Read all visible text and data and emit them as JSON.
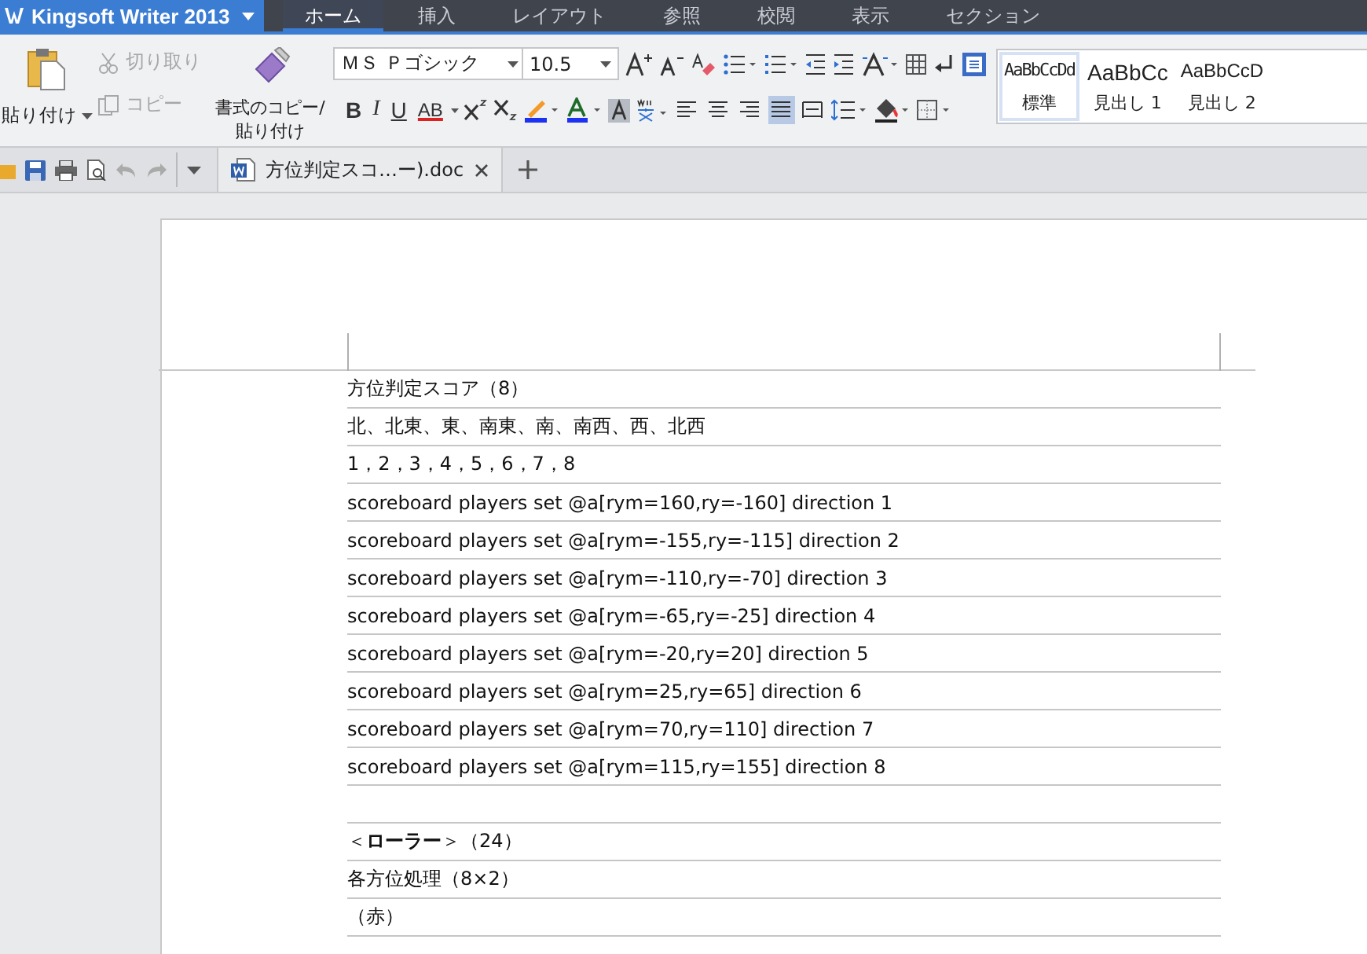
{
  "app": {
    "title": "Kingsoft Writer 2013"
  },
  "menu_tabs": [
    {
      "label": "ホーム",
      "selected": true
    },
    {
      "label": "挿入",
      "selected": false
    },
    {
      "label": "レイアウト",
      "selected": false
    },
    {
      "label": "参照",
      "selected": false
    },
    {
      "label": "校閲",
      "selected": false
    },
    {
      "label": "表示",
      "selected": false
    },
    {
      "label": "セクション",
      "selected": false
    }
  ],
  "clipboard": {
    "paste": "貼り付け",
    "cut": {
      "label": "切り取り",
      "disabled": true
    },
    "copy": {
      "label": "コピー",
      "disabled": true
    },
    "format_painter": [
      "書式のコピー/",
      "貼り付け"
    ]
  },
  "font": {
    "name": "ＭＳ Ｐゴシック",
    "size": "10.5"
  },
  "format_buttons": [
    {
      "label": "B",
      "kind": "bold"
    },
    {
      "label": "I",
      "kind": "italic"
    },
    {
      "label": "U",
      "kind": "underline"
    },
    {
      "label": "AB",
      "kind": "strike"
    }
  ],
  "alignment_buttons": [
    {
      "selected": false
    },
    {
      "selected": false
    },
    {
      "selected": false
    },
    {
      "selected": true
    },
    {
      "selected": false
    }
  ],
  "styles": [
    {
      "preview": "AaBbCcDd",
      "label": "標準",
      "selected": true,
      "kind": "mono"
    },
    {
      "preview": "AaBbCc",
      "label": "見出し 1",
      "selected": false,
      "kind": "large"
    },
    {
      "preview": "AaBbCcD",
      "label": "見出し 2",
      "selected": false,
      "kind": "medium"
    }
  ],
  "document_tab": {
    "title": "方位判定スコ…ー).doc"
  },
  "document_lines": [
    {
      "kind": "text",
      "text": "方位判定スコア（8）"
    },
    {
      "kind": "text",
      "text": "北、北東、東、南東、南、南西、西、北西"
    },
    {
      "kind": "text",
      "text": "1，2，3，4，5，6，7，8"
    },
    {
      "kind": "text",
      "text": "scoreboard players set @a[rym=160,ry=-160] direction 1"
    },
    {
      "kind": "text",
      "text": "scoreboard players set @a[rym=-155,ry=-115] direction 2"
    },
    {
      "kind": "text",
      "text": "scoreboard players set @a[rym=-110,ry=-70] direction 3"
    },
    {
      "kind": "text",
      "text": "scoreboard players set @a[rym=-65,ry=-25] direction 4"
    },
    {
      "kind": "text",
      "text": "scoreboard players set @a[rym=-20,ry=20] direction 5"
    },
    {
      "kind": "text",
      "text": "scoreboard players set @a[rym=25,ry=65] direction 6"
    },
    {
      "kind": "text",
      "text": "scoreboard players set @a[rym=70,ry=110] direction 7"
    },
    {
      "kind": "text",
      "text": "scoreboard players set @a[rym=115,ry=155] direction 8"
    },
    {
      "kind": "blank"
    },
    {
      "kind": "text",
      "text": "＜**ローラー**＞（24）"
    },
    {
      "kind": "text",
      "text": "各方位処理（8×2）"
    },
    {
      "kind": "text",
      "text": "（赤）"
    }
  ]
}
